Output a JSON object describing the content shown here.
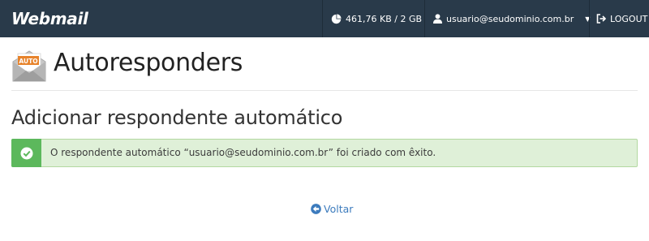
{
  "topbar": {
    "brand": "Webmail",
    "usage": "461,76 KB / 2 GB",
    "user": "usuario@seudominio.com.br",
    "logout": "LOGOUT"
  },
  "header": {
    "icon_label": "AUTO",
    "title": "Autoresponders"
  },
  "main": {
    "section_title": "Adicionar respondente automático",
    "alert_message": "O respondente automático “usuario@seudominio.com.br” foi criado com êxito.",
    "back_label": "Voltar"
  },
  "colors": {
    "topbar": "#293a4a",
    "success_bg": "#dff0d8",
    "success_icon": "#5cb85c",
    "link": "#3c7bbd"
  },
  "icons": [
    "pie-chart-icon",
    "user-icon",
    "caret-down-icon",
    "logout-icon",
    "envelope-auto-icon",
    "check-circle-icon",
    "arrow-circle-left-icon"
  ]
}
